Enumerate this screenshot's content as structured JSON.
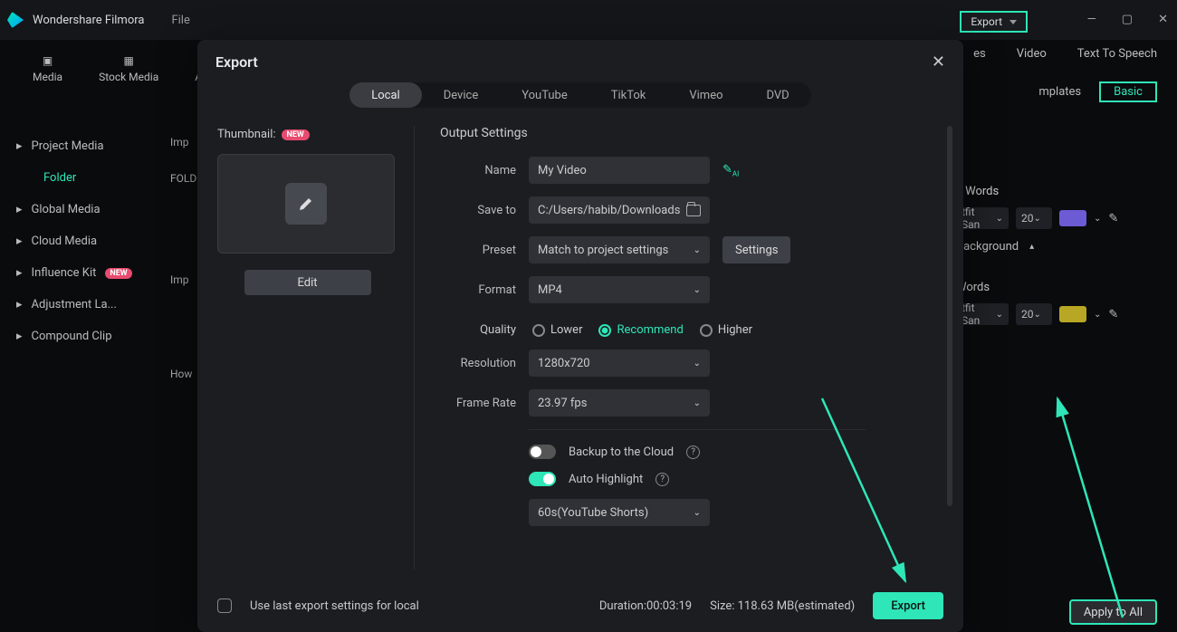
{
  "app": {
    "title": "Wondershare Filmora",
    "menu_file": "File"
  },
  "top_export_btn": "Export",
  "top_right_tabs": {
    "t1": "es",
    "t2": "Video",
    "t3": "Text To Speech",
    "sub1": "mplates",
    "basic": "Basic"
  },
  "tool_tabs": {
    "media": "Media",
    "stock": "Stock Media",
    "audio": "Audio"
  },
  "left_nav": {
    "project_media": "Project Media",
    "folder": "Folder",
    "global_media": "Global Media",
    "cloud_media": "Cloud Media",
    "influence_kit": "Influence Kit",
    "new_badge": "NEW",
    "adjustment": "Adjustment La...",
    "compound": "Compound Clip",
    "col_folder": "FOLD",
    "col_imp": "Imp",
    "col_how": "How"
  },
  "right_panel": {
    "section1": "     e Words",
    "fontsel1": "tfit San",
    "size1": "20",
    "bg_label": "Background",
    "section2": "Words",
    "fontsel2": "tfit San",
    "size2": "20"
  },
  "apply_all": "Apply to All",
  "dialog": {
    "title": "Export",
    "tabs": {
      "local": "Local",
      "device": "Device",
      "youtube": "YouTube",
      "tiktok": "TikTok",
      "vimeo": "Vimeo",
      "dvd": "DVD"
    },
    "thumbnail_label": "Thumbnail:",
    "new_badge": "NEW",
    "edit_btn": "Edit",
    "output_title": "Output Settings",
    "name_label": "Name",
    "name_value": "My Video",
    "saveto_label": "Save to",
    "saveto_value": "C:/Users/habib/Downloads",
    "preset_label": "Preset",
    "preset_value": "Match to project settings",
    "settings_btn": "Settings",
    "format_label": "Format",
    "format_value": "MP4",
    "quality_label": "Quality",
    "q_lower": "Lower",
    "q_recommend": "Recommend",
    "q_higher": "Higher",
    "resolution_label": "Resolution",
    "resolution_value": "1280x720",
    "framerate_label": "Frame Rate",
    "framerate_value": "23.97 fps",
    "backup_label": "Backup to the Cloud",
    "highlight_label": "Auto Highlight",
    "highlight_preset": "60s(YouTube Shorts)",
    "use_last": "Use last export settings for local",
    "duration": "Duration:00:03:19",
    "size": "Size: 118.63 MB(estimated)",
    "export_btn": "Export"
  },
  "chart_data": null
}
